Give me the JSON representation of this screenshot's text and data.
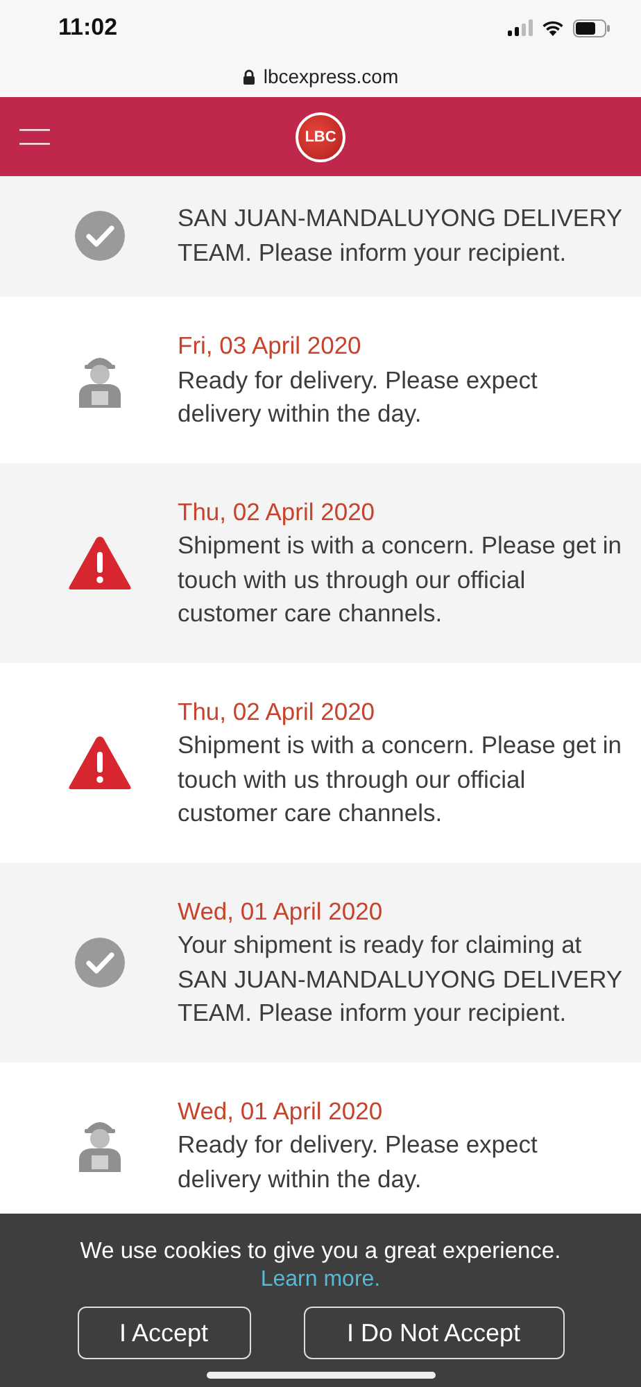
{
  "status_bar": {
    "time": "11:02"
  },
  "address_bar": {
    "url": "lbcexpress.com"
  },
  "header": {
    "logo": "LBC"
  },
  "events": [
    {
      "kind": "claim",
      "text": "SAN JUAN-MANDALUYONG DELIVERY TEAM. Please inform your recipient."
    },
    {
      "kind": "delivery",
      "date": "Fri, 03 April 2020",
      "text": "Ready for delivery. Please expect delivery within the day."
    },
    {
      "kind": "concern",
      "date": "Thu, 02 April 2020",
      "text": "Shipment is with a concern. Please get in touch with us through our official customer care channels."
    },
    {
      "kind": "concern",
      "date": "Thu, 02 April 2020",
      "text": "Shipment is with a concern. Please get in touch with us through our official customer care channels."
    },
    {
      "kind": "claim",
      "date": "Wed, 01 April 2020",
      "text": "Your shipment is ready for claiming at SAN JUAN-MANDALUYONG DELIVERY TEAM. Please inform your recipient."
    },
    {
      "kind": "delivery",
      "date": "Wed, 01 April 2020",
      "text": "Ready for delivery. Please expect delivery within the day."
    }
  ],
  "cookie_banner": {
    "message": "We use cookies to give you a great experience.",
    "link": "Learn more.",
    "buttons": [
      "I Accept",
      "I Do Not Accept"
    ]
  }
}
